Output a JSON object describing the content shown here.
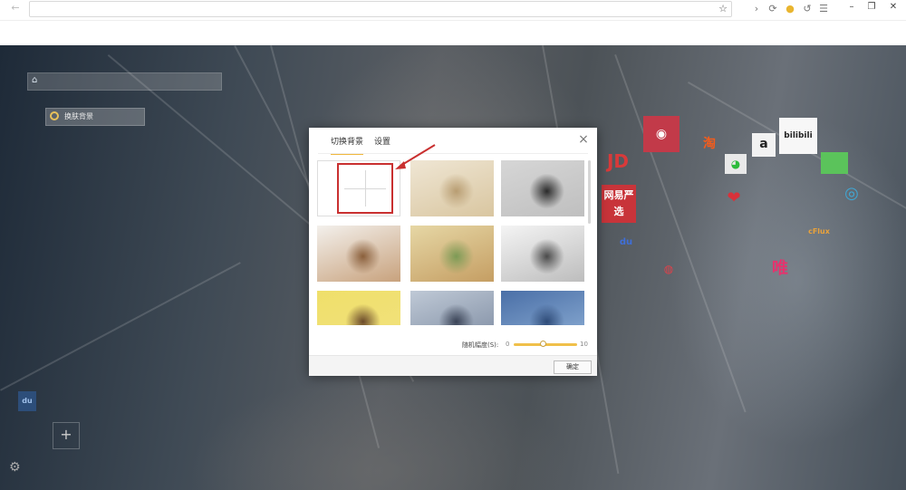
{
  "browser": {
    "toolbar_icons": [
      "back-icon",
      "star-icon",
      "refresh-icon",
      "extension-icon",
      "undo-icon",
      "menu-icon"
    ],
    "window_controls": {
      "minimize": "–",
      "restore": "❐",
      "close": "✕"
    }
  },
  "newtab": {
    "bg_switch_label": "换肤背景",
    "tiles": [
      {
        "name": "tmall-tile",
        "text": "",
        "bg": "#c23a49",
        "fg": "#fff"
      },
      {
        "name": "taobao-tile",
        "text": "淘",
        "bg": "transparent",
        "fg": "#f35c1c"
      },
      {
        "name": "amazon-tile",
        "text": "a",
        "bg": "#f2f2f2",
        "fg": "#222"
      },
      {
        "name": "bilibili-tile",
        "text": "bilibili",
        "bg": "#f7f7f7",
        "fg": "#222"
      },
      {
        "name": "jd-tile",
        "text": "JD",
        "bg": "transparent",
        "fg": "#d83a3a"
      },
      {
        "name": "wechat-tile",
        "text": "",
        "bg": "#e9e9e9",
        "fg": "#2dbb3c"
      },
      {
        "name": "netease-yanxuan-tile",
        "text": "网易严选",
        "bg": "#c8343a",
        "fg": "#fff"
      },
      {
        "name": "baidu-tile",
        "text": "du",
        "bg": "transparent",
        "fg": "#3f6fd8"
      },
      {
        "name": "lips-tile",
        "text": "",
        "bg": "transparent",
        "fg": "#d9313a"
      },
      {
        "name": "weibo-tile",
        "text": "",
        "bg": "transparent",
        "fg": "#e0414a"
      },
      {
        "name": "vip-tile",
        "text": "唯",
        "bg": "transparent",
        "fg": "#e5336e"
      },
      {
        "name": "ctrip-tile",
        "text": "cFlux",
        "bg": "transparent",
        "fg": "#e9a23b"
      },
      {
        "name": "green-tile",
        "text": "",
        "bg": "#5bc35b",
        "fg": "#fff"
      },
      {
        "name": "circle-tile",
        "text": "",
        "bg": "transparent",
        "fg": "#3fa8d6"
      },
      {
        "name": "left-du-tile",
        "text": "du",
        "bg": "#2d4e7a",
        "fg": "#9fc0ea"
      }
    ]
  },
  "dialog": {
    "tabs": [
      {
        "label": "切换背景",
        "active": true
      },
      {
        "label": "设置",
        "active": false
      }
    ],
    "close_label": "×",
    "thumbnails": [
      {
        "name": "custom-upload-thumb",
        "kind": "custom"
      },
      {
        "name": "thumb-beach-woman",
        "kind": "image",
        "colors": [
          "#efe6d4",
          "#d9c6a0",
          "#b89d72"
        ]
      },
      {
        "name": "thumb-man-suit",
        "kind": "image",
        "colors": [
          "#d6d6d6",
          "#bfbfbf",
          "#2a2a2a"
        ]
      },
      {
        "name": "thumb-singer-mic",
        "kind": "image",
        "colors": [
          "#f3f0ec",
          "#c8a27d",
          "#8a5f3b"
        ]
      },
      {
        "name": "thumb-blonde-woman",
        "kind": "image",
        "colors": [
          "#e6d7a5",
          "#c59e63",
          "#7c9a55"
        ]
      },
      {
        "name": "thumb-anime-sketch",
        "kind": "image",
        "colors": [
          "#f4f4f4",
          "#bdbdbd",
          "#4a4a4a"
        ]
      },
      {
        "name": "thumb-yellow-cartoon",
        "kind": "image",
        "colors": [
          "#efdf6a",
          "#f2e27e",
          "#6b4a2a"
        ]
      },
      {
        "name": "thumb-anime-girl",
        "kind": "image",
        "colors": [
          "#bfc9d6",
          "#7c8aa0",
          "#3a4356"
        ]
      },
      {
        "name": "thumb-sea-sky",
        "kind": "image",
        "colors": [
          "#4a6fa7",
          "#8fb0d6",
          "#2e4b78"
        ]
      }
    ],
    "slider": {
      "label": "随机幅度(S):",
      "min": "0",
      "max": "10",
      "value_fraction": 0.45
    },
    "ok_label": "确定"
  },
  "colors": {
    "accent": "#f0b73c",
    "highlight": "#c93030"
  }
}
